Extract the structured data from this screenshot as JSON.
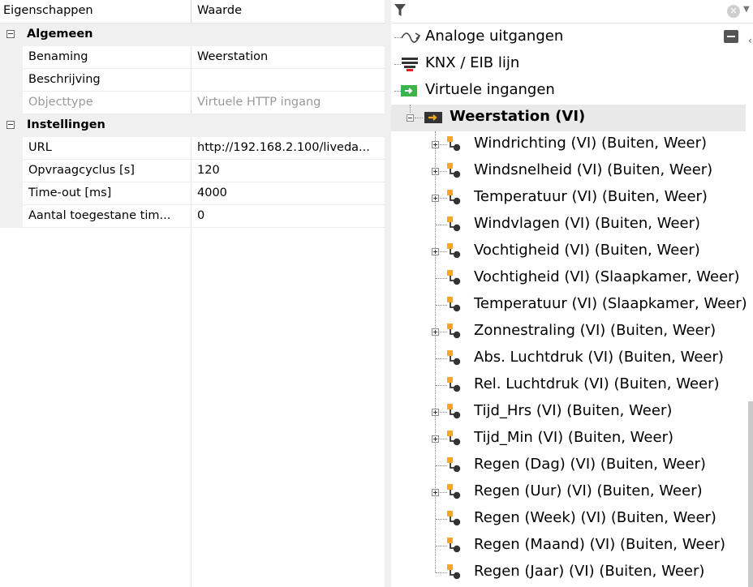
{
  "properties": {
    "headers": {
      "name": "Eigenschappen",
      "value": "Waarde"
    },
    "categories": [
      {
        "label": "Algemeen",
        "rows": [
          {
            "name": "Benaming",
            "value": "Weerstation",
            "readonly": false
          },
          {
            "name": "Beschrijving",
            "value": "",
            "readonly": false
          },
          {
            "name": "Objecttype",
            "value": "Virtuele HTTP ingang",
            "readonly": true
          }
        ]
      },
      {
        "label": "Instellingen",
        "rows": [
          {
            "name": "URL",
            "value": "http://192.168.2.100/liveda...",
            "readonly": false
          },
          {
            "name": "Opvraagcyclus [s]",
            "value": "120",
            "readonly": false
          },
          {
            "name": "Time-out [ms]",
            "value": "4000",
            "readonly": false
          },
          {
            "name": "Aantal toegestane tim...",
            "value": "0",
            "readonly": false
          }
        ]
      }
    ]
  },
  "tree": {
    "top_items": [
      {
        "label": "Analoge uitgangen",
        "icon": "analog-output-icon"
      },
      {
        "label": "KNX / EIB lijn",
        "icon": "knx-line-icon"
      },
      {
        "label": "Virtuele ingangen",
        "icon": "virtual-input-folder-icon"
      }
    ],
    "selected": {
      "label": "Weerstation (VI)",
      "icon": "virtual-http-input-icon"
    },
    "children": [
      {
        "label": "Windrichting (VI) (Buiten, Weer)",
        "expandable": true
      },
      {
        "label": "Windsnelheid (VI) (Buiten, Weer)",
        "expandable": true
      },
      {
        "label": "Temperatuur (VI) (Buiten, Weer)",
        "expandable": true
      },
      {
        "label": "Windvlagen (VI) (Buiten, Weer)",
        "expandable": false
      },
      {
        "label": "Vochtigheid (VI) (Buiten, Weer)",
        "expandable": true
      },
      {
        "label": "Vochtigheid (VI) (Slaapkamer, Weer)",
        "expandable": false
      },
      {
        "label": "Temperatuur (VI) (Slaapkamer, Weer)",
        "expandable": false
      },
      {
        "label": "Zonnestraling (VI) (Buiten, Weer)",
        "expandable": true
      },
      {
        "label": "Abs. Luchtdruk (VI) (Buiten, Weer)",
        "expandable": false
      },
      {
        "label": "Rel. Luchtdruk (VI) (Buiten, Weer)",
        "expandable": false
      },
      {
        "label": "Tijd_Hrs (VI) (Buiten, Weer)",
        "expandable": true
      },
      {
        "label": "Tijd_Min (VI) (Buiten, Weer)",
        "expandable": true
      },
      {
        "label": "Regen (Dag) (VI) (Buiten, Weer)",
        "expandable": false
      },
      {
        "label": "Regen (Uur) (VI) (Buiten, Weer)",
        "expandable": true
      },
      {
        "label": "Regen (Week) (VI) (Buiten, Weer)",
        "expandable": false
      },
      {
        "label": "Regen (Maand) (VI) (Buiten, Weer)",
        "expandable": false
      },
      {
        "label": "Regen (Jaar) (VI) (Buiten, Weer)",
        "expandable": false
      }
    ],
    "colors": {
      "orange": "#f5a623",
      "green": "#3cb44b",
      "dark": "#333333",
      "knx_red": "#e02020"
    }
  }
}
